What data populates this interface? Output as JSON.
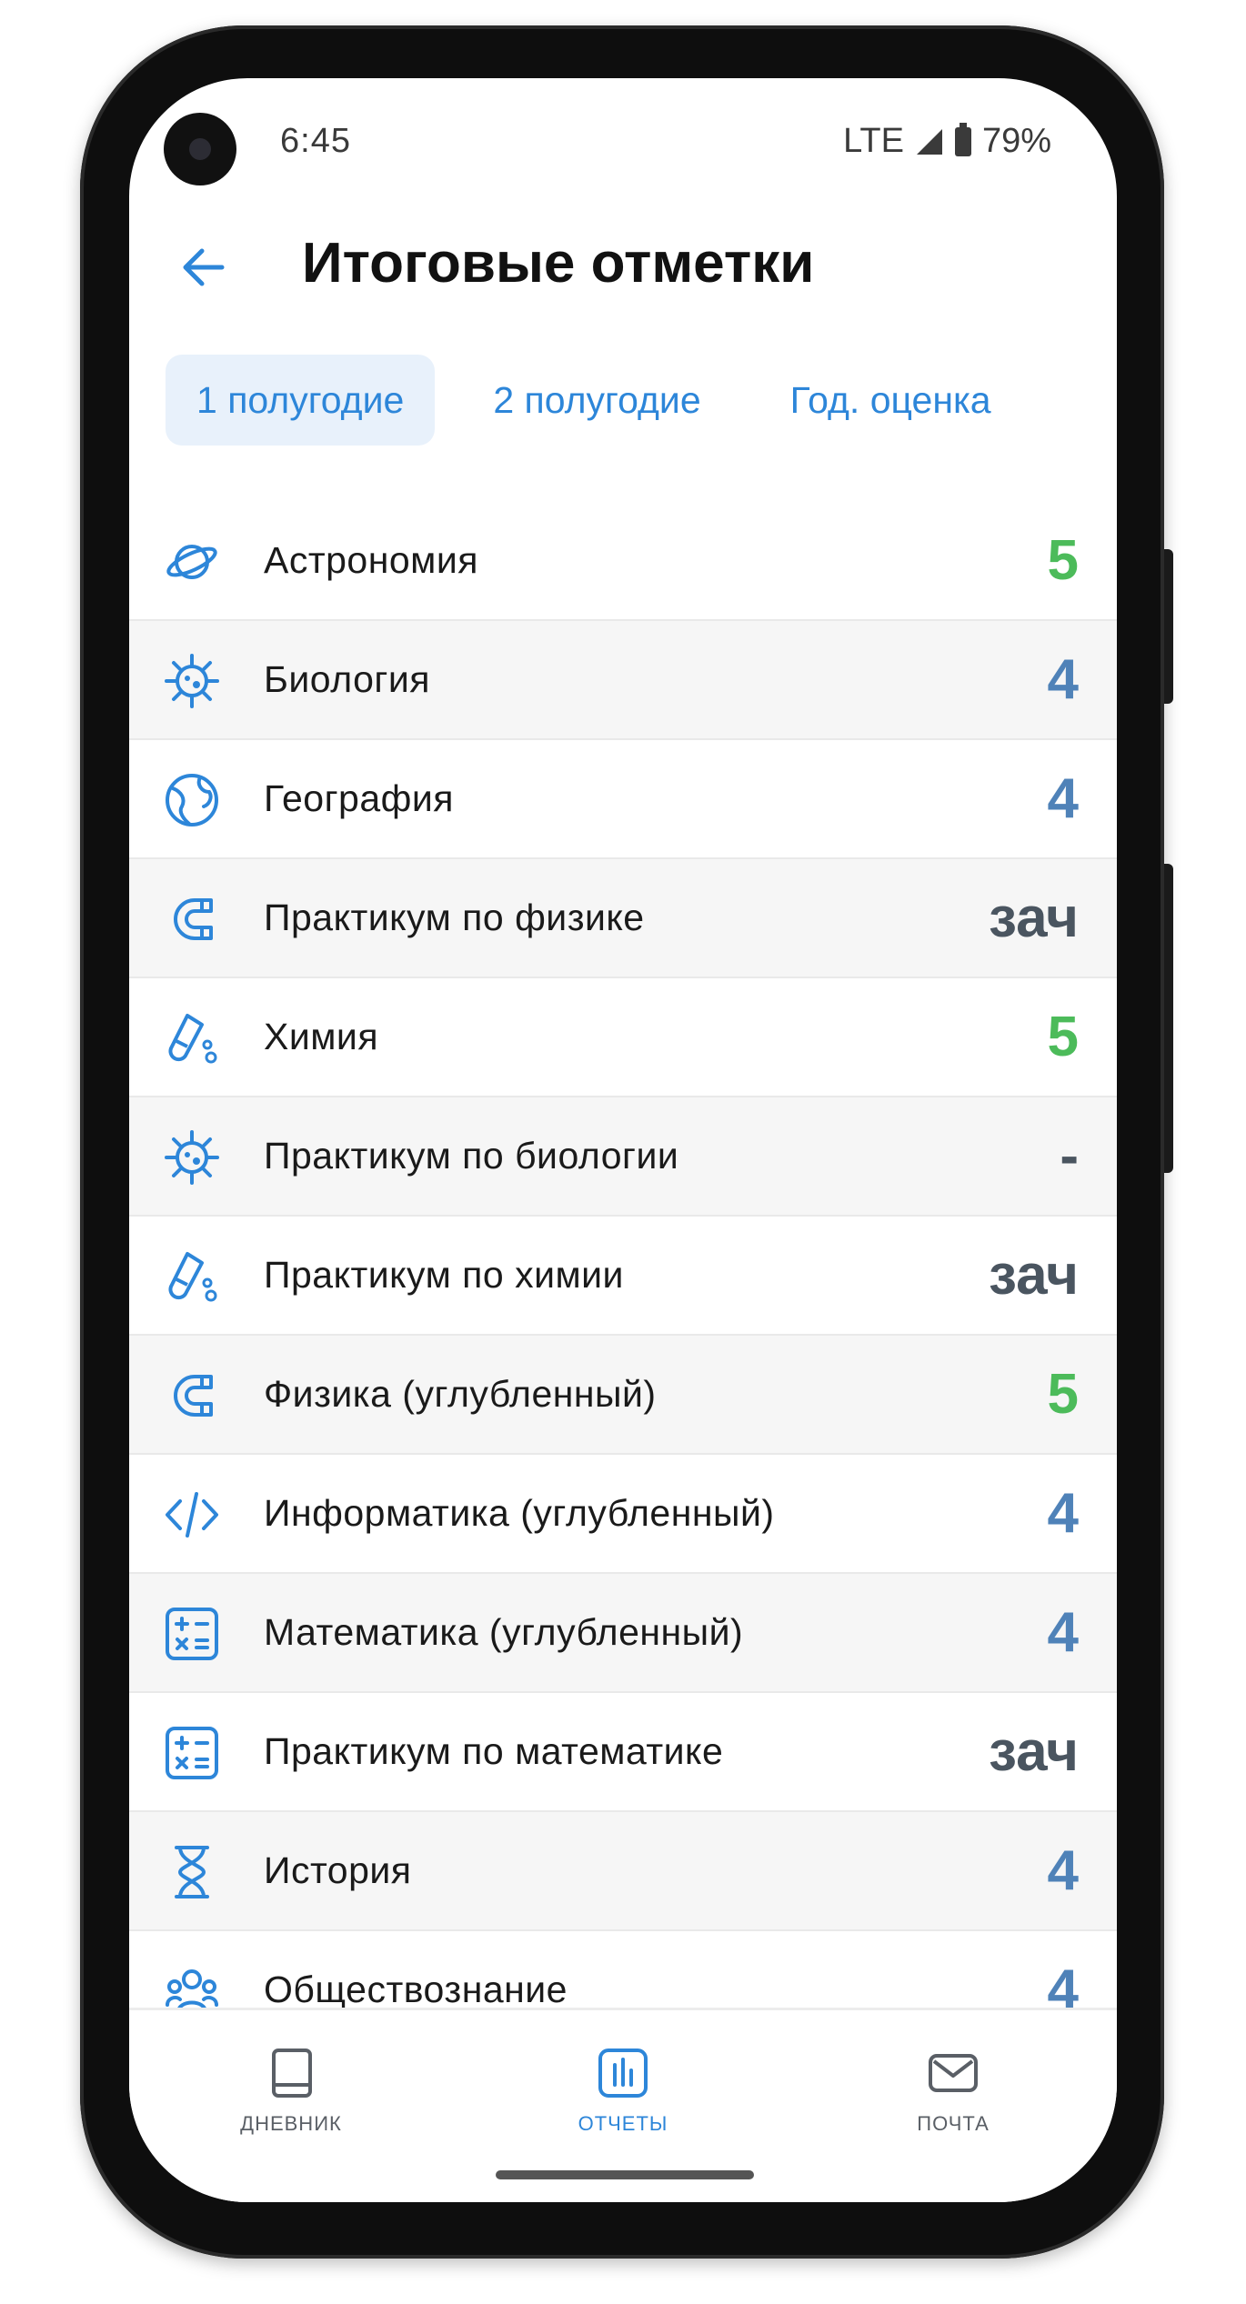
{
  "status_bar": {
    "time": "6:45",
    "network": "LTE",
    "battery": "79%"
  },
  "header": {
    "title": "Итоговые отметки"
  },
  "tabs": [
    {
      "label": "1 полугодие",
      "active": true
    },
    {
      "label": "2 полугодие",
      "active": false
    },
    {
      "label": "Год. оценка",
      "active": false
    }
  ],
  "subjects": [
    {
      "name": "Астрономия",
      "grade": "5",
      "icon": "planet-icon"
    },
    {
      "name": "Биология",
      "grade": "4",
      "icon": "virus-icon"
    },
    {
      "name": "География",
      "grade": "4",
      "icon": "globe-icon"
    },
    {
      "name": "Практикум по физике",
      "grade": "зач",
      "icon": "magnet-icon"
    },
    {
      "name": "Химия",
      "grade": "5",
      "icon": "flask-icon"
    },
    {
      "name": "Практикум по биологии",
      "grade": "-",
      "icon": "virus-icon"
    },
    {
      "name": "Практикум по химии",
      "grade": "зач",
      "icon": "flask-icon"
    },
    {
      "name": "Физика (углубленный)",
      "grade": "5",
      "icon": "magnet-icon"
    },
    {
      "name": "Информатика (углубленный)",
      "grade": "4",
      "icon": "code-icon"
    },
    {
      "name": "Математика (углубленный)",
      "grade": "4",
      "icon": "calculator-icon"
    },
    {
      "name": "Практикум по математике",
      "grade": "зач",
      "icon": "calculator-icon"
    },
    {
      "name": "История",
      "grade": "4",
      "icon": "hourglass-icon"
    },
    {
      "name": "Обществознание",
      "grade": "4",
      "icon": "people-icon"
    }
  ],
  "bottom_nav": [
    {
      "label": "ДНЕВНИК",
      "icon": "book-icon",
      "active": false
    },
    {
      "label": "ОТЧЕТЫ",
      "icon": "chart-icon",
      "active": true
    },
    {
      "label": "ПОЧТА",
      "icon": "mail-icon",
      "active": false
    }
  ],
  "colors": {
    "accent": "#2d86d9",
    "grade_5": "#4cbb5a",
    "grade_4": "#4f82b8",
    "grade_other": "#4a5560"
  }
}
